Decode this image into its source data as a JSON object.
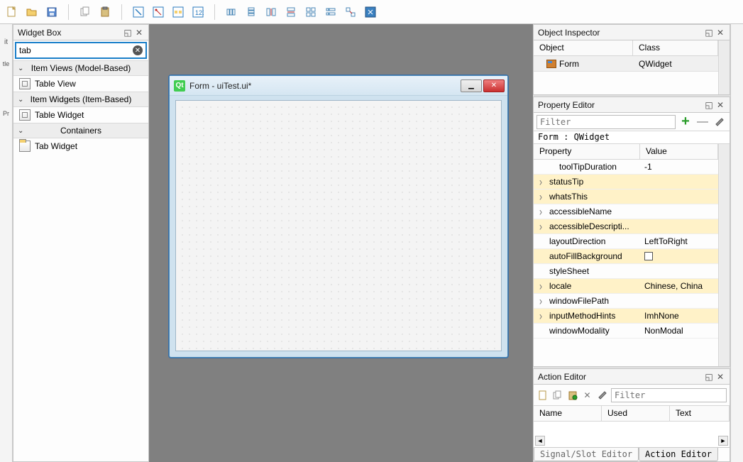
{
  "toolbar": {
    "groups": [
      [
        "new-file",
        "open-file",
        "save-file"
      ],
      [
        "copy",
        "paste"
      ],
      [
        "edit-widgets",
        "edit-signals",
        "edit-buddies",
        "edit-tab-order"
      ],
      [
        "layout-h",
        "layout-v",
        "layout-h-split",
        "layout-v-split",
        "layout-grid",
        "layout-form",
        "break-layout",
        "adjust-size"
      ]
    ]
  },
  "widget_box": {
    "title": "Widget Box",
    "search_value": "tab",
    "categories": [
      {
        "label": "Item Views (Model-Based)",
        "items": [
          {
            "label": "Table View",
            "icon": "table"
          }
        ]
      },
      {
        "label": "Item Widgets (Item-Based)",
        "items": [
          {
            "label": "Table Widget",
            "icon": "table"
          }
        ]
      },
      {
        "label": "Containers",
        "items": [
          {
            "label": "Tab Widget",
            "icon": "tab"
          }
        ]
      }
    ]
  },
  "form": {
    "title": "Form - uiTest.ui*"
  },
  "object_inspector": {
    "title": "Object Inspector",
    "columns": [
      "Object",
      "Class"
    ],
    "rows": [
      {
        "object": "Form",
        "class": "QWidget"
      }
    ]
  },
  "property_editor": {
    "title": "Property Editor",
    "filter_placeholder": "Filter",
    "context": "Form : QWidget",
    "columns": [
      "Property",
      "Value"
    ],
    "rows": [
      {
        "name": "toolTipDuration",
        "value": "-1",
        "expandable": false,
        "hl": false,
        "indent": true
      },
      {
        "name": "statusTip",
        "value": "",
        "expandable": true,
        "hl": true
      },
      {
        "name": "whatsThis",
        "value": "",
        "expandable": true,
        "hl": true
      },
      {
        "name": "accessibleName",
        "value": "",
        "expandable": true,
        "hl": false
      },
      {
        "name": "accessibleDescripti...",
        "value": "",
        "expandable": true,
        "hl": true
      },
      {
        "name": "layoutDirection",
        "value": "LeftToRight",
        "expandable": false,
        "hl": false
      },
      {
        "name": "autoFillBackground",
        "value": "__checkbox__",
        "expandable": false,
        "hl": true
      },
      {
        "name": "styleSheet",
        "value": "",
        "expandable": false,
        "hl": false
      },
      {
        "name": "locale",
        "value": "Chinese, China",
        "expandable": true,
        "hl": true
      },
      {
        "name": "windowFilePath",
        "value": "",
        "expandable": true,
        "hl": false
      },
      {
        "name": "inputMethodHints",
        "value": "ImhNone",
        "expandable": true,
        "hl": true
      },
      {
        "name": "windowModality",
        "value": "NonModal",
        "expandable": false,
        "hl": false
      }
    ]
  },
  "action_editor": {
    "title": "Action Editor",
    "filter_placeholder": "Filter",
    "columns": [
      "Name",
      "Used",
      "Text"
    ],
    "tabs": [
      "Signal/Slot Editor",
      "Action Editor"
    ]
  }
}
